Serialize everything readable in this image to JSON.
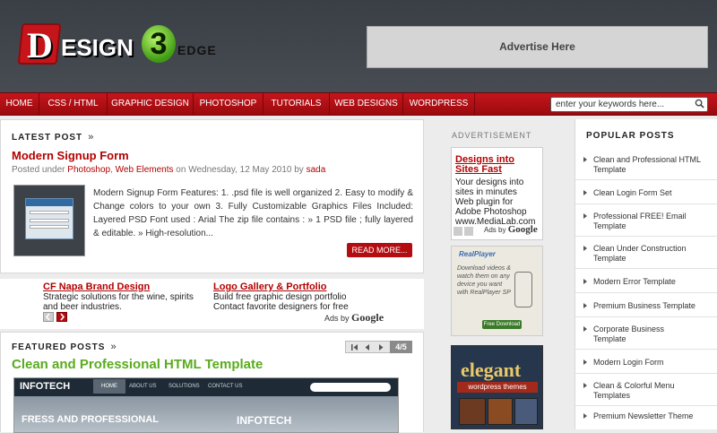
{
  "header": {
    "logo_letter": "D",
    "logo_word": "ESIGN",
    "logo_number": "3",
    "logo_suffix": "EDGE",
    "ad_label": "Advertise Here"
  },
  "nav": {
    "items": [
      "HOME",
      "CSS / HTML",
      "GRAPHIC DESIGN",
      "PHOTOSHOP",
      "TUTORIALS",
      "WEB DESIGNS",
      "WORDPRESS"
    ],
    "search_placeholder": "enter your keywords here..."
  },
  "latest": {
    "section_title": "LATEST POST",
    "arrows": "»",
    "title": "Modern Signup Form",
    "meta_prefix": "Posted under",
    "cat1": "Photoshop",
    "cat2": "Web Elements",
    "meta_on": "on Wednesday, 12 May 2010 by",
    "author": "sada",
    "excerpt": "Modern Signup Form Features: 1. .psd file is well organized 2. Easy to modify & Change colors to your own 3. Fully Customizable Graphics Files Included: Layered PSD Font used : Arial The zip file contains : » 1 PSD file ; fully layered & editable. » High-resolution...",
    "read_more": "READ MORE..."
  },
  "ads_row": {
    "ad1_title": "CF Napa Brand Design",
    "ad1_line1": "Strategic solutions for the wine, spirits",
    "ad1_line2": "and beer industries.",
    "ad2_title": "Logo Gallery & Portfolio",
    "ad2_line1": "Build free graphic design portfolio",
    "ad2_line2": "Contact favorite designers for free",
    "ads_by": "Ads by",
    "google": "Google"
  },
  "featured": {
    "section_title": "FEATURED POSTS",
    "arrows": "»",
    "counter": "4/5",
    "title": "Clean and Professional HTML Template",
    "preview_logo": "INFOTECH",
    "preview_nav": [
      "HOME",
      "ABOUT US",
      "SOLUTIONS",
      "CONTACT US"
    ],
    "preview_heading": "FRESS AND PROFESSIONAL",
    "preview_logo2": "INFOTECH"
  },
  "middle": {
    "label": "ADVERTISEMENT",
    "ad_title1": "Designs into",
    "ad_title2": "Sites Fast",
    "ad_body1": "Your designs into",
    "ad_body2": "sites in minutes",
    "ad_body3": "Web plugin for",
    "ad_body4": "Adobe Photoshop",
    "ad_url": "www.MediaLab.com",
    "ads_by": "Ads by",
    "google": "Google",
    "realplayer_brand": "RealPlayer",
    "realplayer_text1": "Download videos &",
    "realplayer_text2": "watch them on any",
    "realplayer_text3": "device you want",
    "realplayer_text4": "with RealPlayer SP",
    "realplayer_btn": "Free Download",
    "elegant_title": "elegant",
    "elegant_sub": "wordpress themes"
  },
  "popular": {
    "title": "POPULAR POSTS",
    "items": [
      [
        "Clean and Professional HTML",
        "Template"
      ],
      [
        "Clean Login Form Set",
        ""
      ],
      [
        "Professional FREE! Email",
        "Template"
      ],
      [
        "Clean Under Construction",
        "Template"
      ],
      [
        "Modern Error Template",
        ""
      ],
      [
        "Premium Business Template",
        ""
      ],
      [
        "Corporate Business",
        "Template"
      ],
      [
        "Modern Login Form",
        ""
      ],
      [
        "Clean & Colorful Menu",
        "Templates"
      ],
      [
        "Premium Newsletter Theme",
        ""
      ]
    ]
  },
  "colors": {
    "accent": "#b30d12",
    "green_title": "#5aab1e",
    "header_bg": "#3d4249"
  }
}
